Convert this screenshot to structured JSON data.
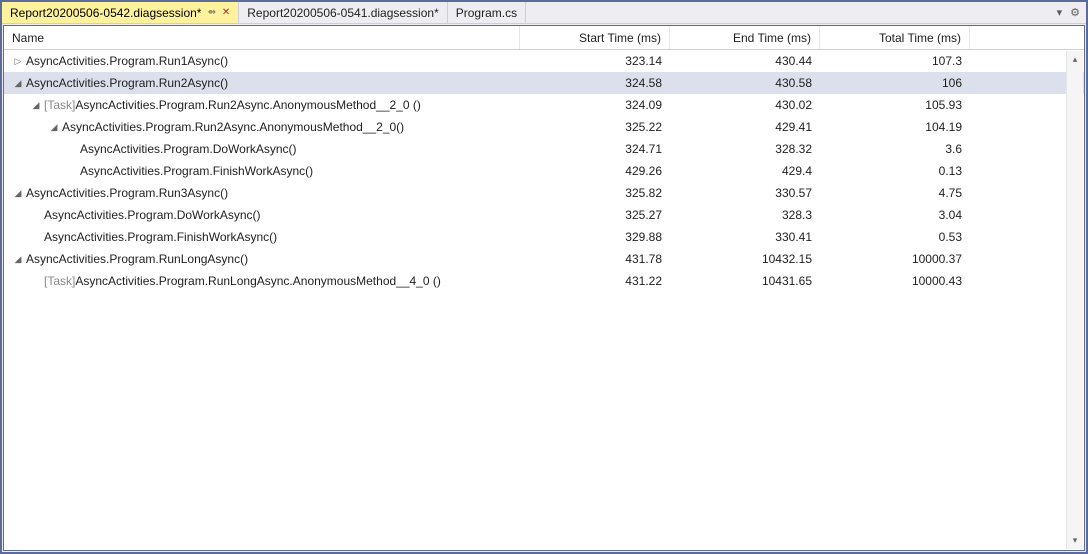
{
  "tabs": [
    {
      "label": "Report20200506-0542.diagsession*",
      "active": true,
      "pinned": true,
      "closable": true
    },
    {
      "label": "Report20200506-0541.diagsession*",
      "active": false,
      "pinned": false,
      "closable": false
    },
    {
      "label": "Program.cs",
      "active": false,
      "pinned": false,
      "closable": false
    }
  ],
  "columns": {
    "name": "Name",
    "start": "Start Time (ms)",
    "end": "End Time (ms)",
    "total": "Total Time (ms)"
  },
  "rows": [
    {
      "depth": 0,
      "expander": "right",
      "task": false,
      "name": "AsyncActivities.Program.Run1Async()",
      "start": "323.14",
      "end": "430.44",
      "total": "107.3",
      "selected": false
    },
    {
      "depth": 0,
      "expander": "down",
      "task": false,
      "name": "AsyncActivities.Program.Run2Async()",
      "start": "324.58",
      "end": "430.58",
      "total": "106",
      "selected": true
    },
    {
      "depth": 1,
      "expander": "down",
      "task": true,
      "name": "AsyncActivities.Program.Run2Async.AnonymousMethod__2_0 ()",
      "start": "324.09",
      "end": "430.02",
      "total": "105.93",
      "selected": false
    },
    {
      "depth": 2,
      "expander": "down",
      "task": false,
      "name": "AsyncActivities.Program.Run2Async.AnonymousMethod__2_0()",
      "start": "325.22",
      "end": "429.41",
      "total": "104.19",
      "selected": false
    },
    {
      "depth": 3,
      "expander": "none",
      "task": false,
      "name": "AsyncActivities.Program.DoWorkAsync()",
      "start": "324.71",
      "end": "328.32",
      "total": "3.6",
      "selected": false
    },
    {
      "depth": 3,
      "expander": "none",
      "task": false,
      "name": "AsyncActivities.Program.FinishWorkAsync()",
      "start": "429.26",
      "end": "429.4",
      "total": "0.13",
      "selected": false
    },
    {
      "depth": 0,
      "expander": "down",
      "task": false,
      "name": "AsyncActivities.Program.Run3Async()",
      "start": "325.82",
      "end": "330.57",
      "total": "4.75",
      "selected": false
    },
    {
      "depth": 1,
      "expander": "none",
      "task": false,
      "name": "AsyncActivities.Program.DoWorkAsync()",
      "start": "325.27",
      "end": "328.3",
      "total": "3.04",
      "selected": false
    },
    {
      "depth": 1,
      "expander": "none",
      "task": false,
      "name": "AsyncActivities.Program.FinishWorkAsync()",
      "start": "329.88",
      "end": "330.41",
      "total": "0.53",
      "selected": false
    },
    {
      "depth": 0,
      "expander": "down",
      "task": false,
      "name": "AsyncActivities.Program.RunLongAsync()",
      "start": "431.78",
      "end": "10432.15",
      "total": "10000.37",
      "selected": false
    },
    {
      "depth": 1,
      "expander": "none",
      "task": true,
      "name": "AsyncActivities.Program.RunLongAsync.AnonymousMethod__4_0 ()",
      "start": "431.22",
      "end": "10431.65",
      "total": "10000.43",
      "selected": false
    }
  ],
  "task_tag": "[Task] ",
  "icons": {
    "pin": "⇴",
    "close": "✕",
    "dropdown": "▾",
    "gear": "⚙",
    "exp_right": "▷",
    "exp_down": "◢",
    "scroll_up": "▴",
    "scroll_down": "▾"
  }
}
